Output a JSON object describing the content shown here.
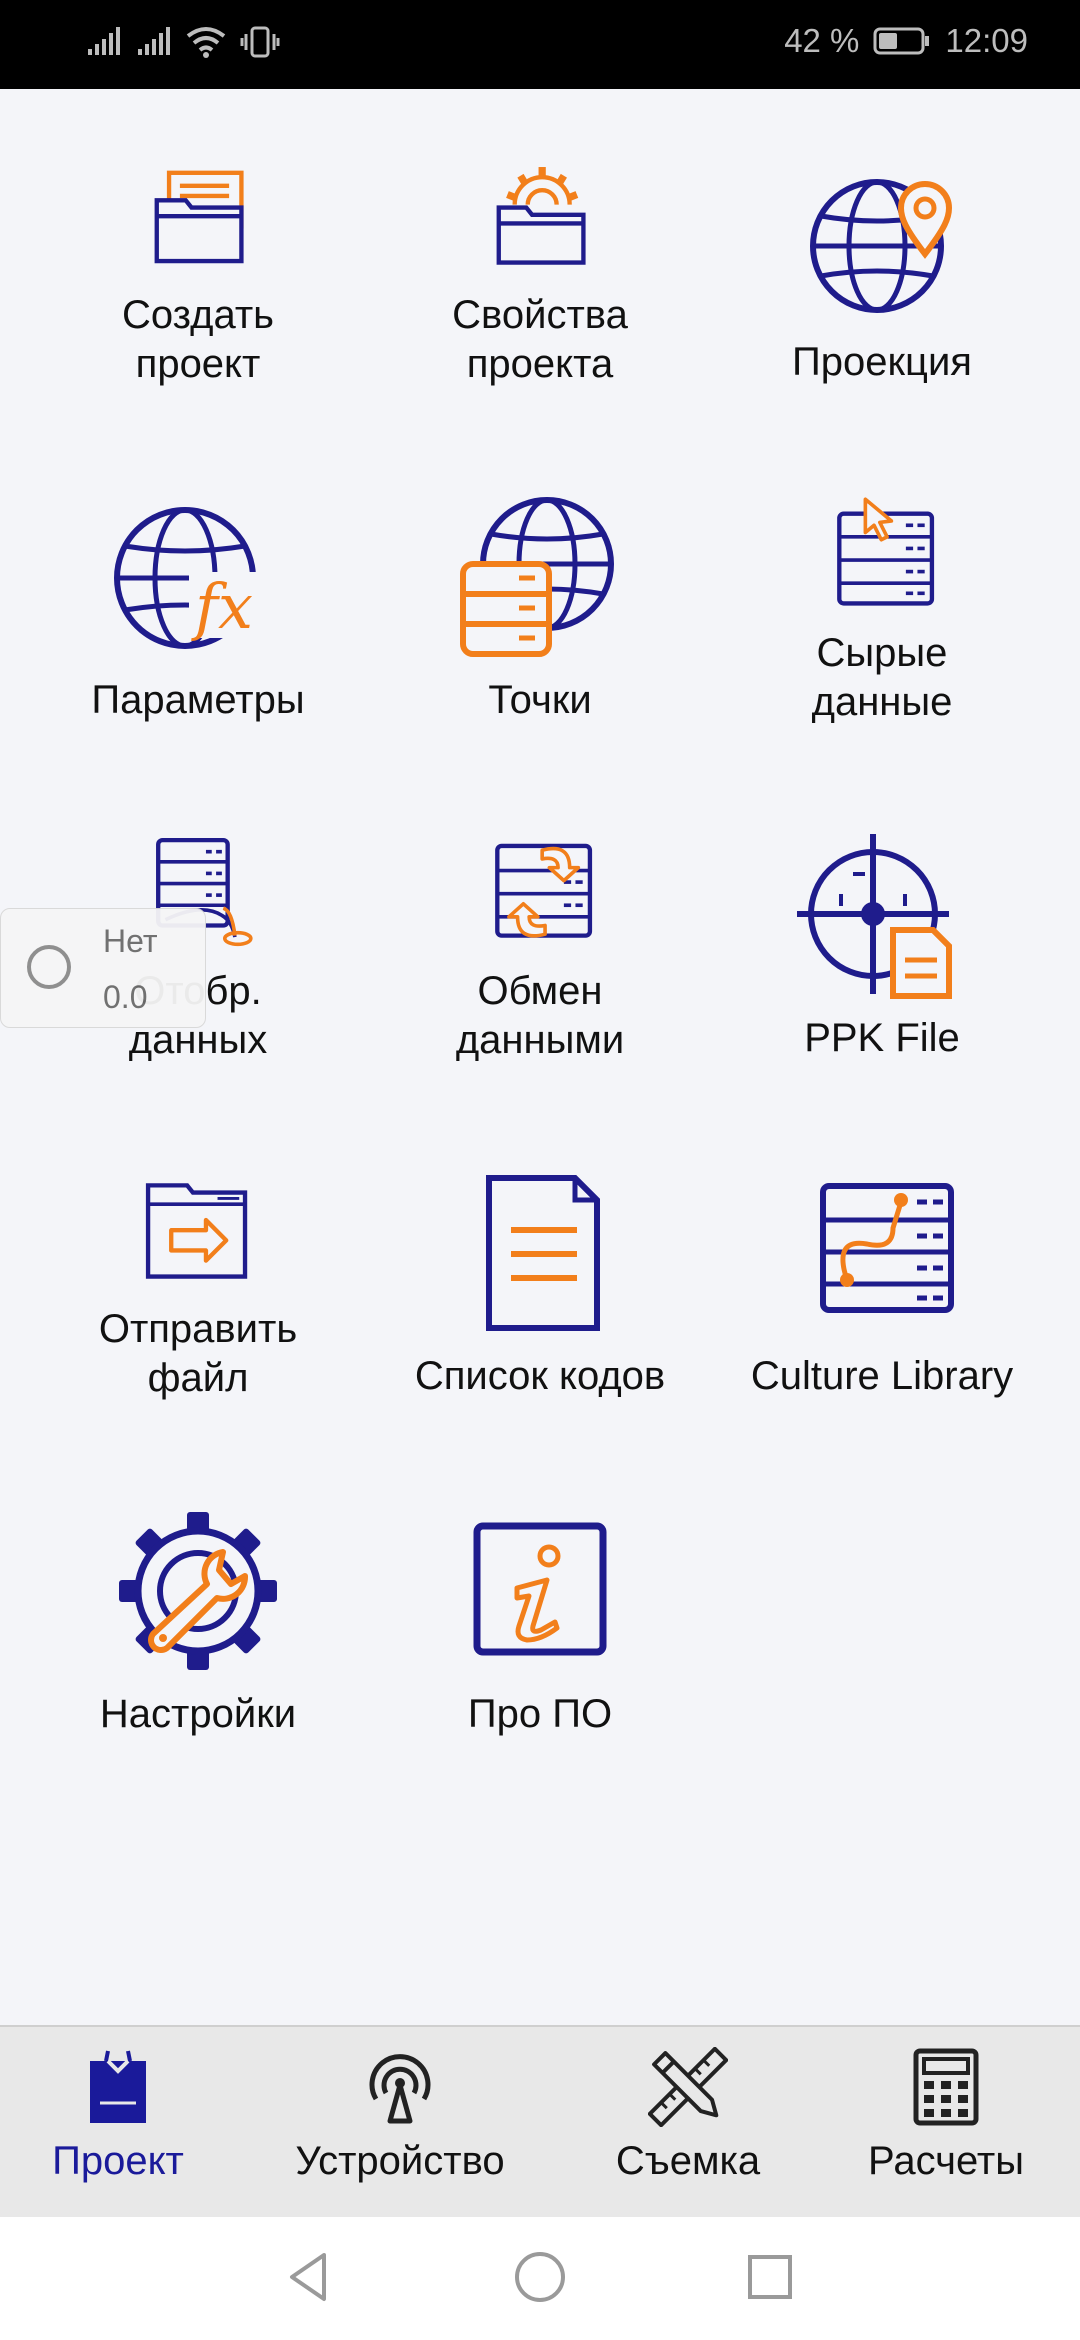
{
  "status_bar": {
    "battery_percent": "42 %",
    "time": "12:09",
    "icons": [
      "signal-icon",
      "signal-icon",
      "wifi-icon",
      "vibrate-icon",
      "battery-icon"
    ]
  },
  "colors": {
    "accent_blue": "#1f1c8c",
    "accent_orange": "#f27f1b",
    "active_tab": "#1a1a9a"
  },
  "menu": {
    "items": [
      {
        "label": "Создать\nпроект",
        "icon": "folder-document-icon"
      },
      {
        "label": "Свойства\nпроекта",
        "icon": "folder-gear-icon"
      },
      {
        "label": "Проекция",
        "icon": "globe-pin-icon"
      },
      {
        "label": "Параметры",
        "icon": "globe-function-icon"
      },
      {
        "label": "Точки",
        "icon": "globe-database-icon"
      },
      {
        "label": "Сырые\nданные",
        "icon": "raw-data-cursor-icon"
      },
      {
        "label": "Отобр.\nданных",
        "icon": "data-display-icon"
      },
      {
        "label": "Обмен\nданными",
        "icon": "data-exchange-icon"
      },
      {
        "label": "PPK File",
        "icon": "crosshair-file-icon"
      },
      {
        "label": "Отправить\nфайл",
        "icon": "folder-send-icon"
      },
      {
        "label": "Список кодов",
        "icon": "document-list-icon"
      },
      {
        "label": "Culture Library",
        "icon": "data-path-icon"
      },
      {
        "label": "Настройки",
        "icon": "settings-wrench-icon"
      },
      {
        "label": "Про ПО",
        "icon": "info-icon"
      }
    ]
  },
  "floating_status": {
    "line1": "Нет",
    "line2": "0.0"
  },
  "tabs": [
    {
      "label": "Проект",
      "icon": "clipboard-icon",
      "active": true
    },
    {
      "label": "Устройство",
      "icon": "antenna-icon",
      "active": false
    },
    {
      "label": "Съемка",
      "icon": "pencil-ruler-icon",
      "active": false
    },
    {
      "label": "Расчеты",
      "icon": "calculator-icon",
      "active": false
    }
  ],
  "system_nav": [
    "back-icon",
    "home-icon",
    "recents-icon"
  ]
}
